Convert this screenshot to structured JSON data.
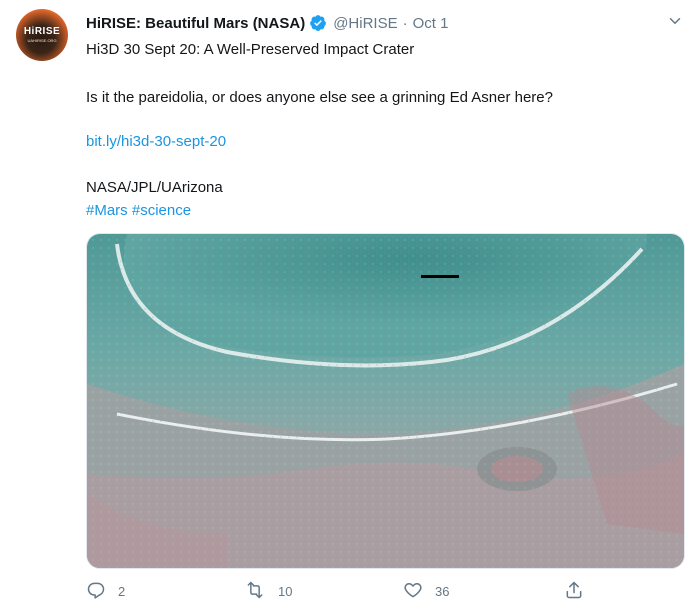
{
  "tweet": {
    "avatar": {
      "brand": "HiRISE",
      "sub": "UAHIRISE.ORG"
    },
    "author": {
      "name": "HiRISE: Beautiful Mars (NASA)",
      "handle": "@HiRISE",
      "separator": "·",
      "time": "Oct 1",
      "verified": true
    },
    "text": {
      "line1": "Hi3D 30 Sept 20: A Well-Preserved Impact Crater",
      "line2": "Is it the pareidolia, or does anyone else see a grinning Ed Asner here?",
      "link": "bit.ly/hi3d-30-sept-20",
      "credit": "NASA/JPL/UArizona",
      "hashtags": [
        "#Mars",
        "#science"
      ]
    },
    "media": {
      "description_icon": "mars-crater-anaglyph-image"
    },
    "actions": {
      "reply": {
        "icon": "reply-icon",
        "count": "2"
      },
      "retweet": {
        "icon": "retweet-icon",
        "count": "10"
      },
      "like": {
        "icon": "heart-icon",
        "count": "36"
      },
      "share": {
        "icon": "share-icon"
      }
    },
    "colors": {
      "link": "#1b95e0",
      "muted": "#657786",
      "verified": "#1da1f2",
      "avatar": "#e0662a"
    }
  }
}
